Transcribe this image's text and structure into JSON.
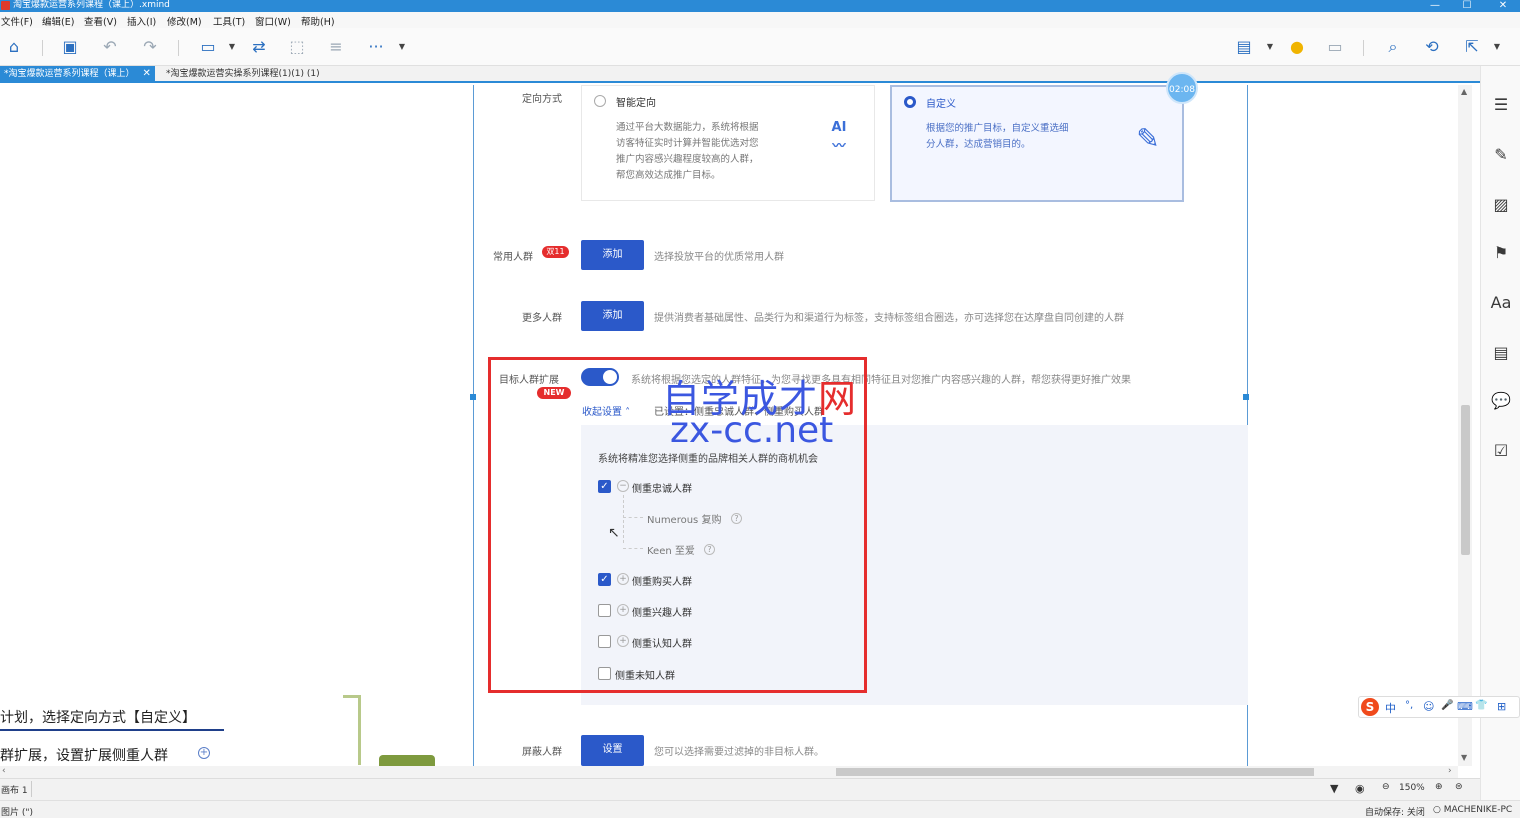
{
  "window": {
    "title": "淘宝爆款运营系列课程（课上）.xmind",
    "controls": [
      "—",
      "☐",
      "✕"
    ]
  },
  "menu": [
    "文件(F)",
    "编辑(E)",
    "查看(V)",
    "插入(I)",
    "修改(M)",
    "工具(T)",
    "窗口(W)",
    "帮助(H)"
  ],
  "toolbar": {
    "left_icons": [
      "home-icon",
      "save-icon",
      "undo-icon",
      "redo-icon",
      "topic-icon",
      "relationship-icon",
      "boundary-icon",
      "summary-icon",
      "more-icon"
    ],
    "right_icons": [
      "presentation-icon",
      "idea-icon",
      "layout-icon",
      "search-icon",
      "share-icon",
      "export-icon"
    ]
  },
  "tabs": [
    {
      "label": "*淘宝爆款运营系列课程（课上）",
      "active": true
    },
    {
      "label": "*淘宝爆款运营实操系列课程(1)(1) (1)",
      "active": false
    }
  ],
  "right_sidebar": [
    "outline-icon",
    "format-icon",
    "image-icon",
    "marker-icon",
    "style-icon",
    "notes-icon",
    "comment-icon",
    "task-icon"
  ],
  "shot": {
    "timer": "02:08",
    "targeting": {
      "label": "定向方式",
      "options": [
        {
          "title": "智能定向",
          "desc": [
            "通过平台大数据能力，系统将根据",
            "访客特征实时计算并智能优选对您",
            "推广内容感兴趣程度较高的人群，",
            "帮您高效达成推广目标。"
          ],
          "selected": false,
          "icon_label": "AI"
        },
        {
          "title": "自定义",
          "desc": [
            "根据您的推广目标，自定义重选细",
            "分人群，达成营销目的。"
          ],
          "selected": true
        }
      ]
    },
    "common_crowd": {
      "label": "常用人群",
      "badge": "双11",
      "button": "添加",
      "hint": "选择投放平台的优质常用人群"
    },
    "more_crowd": {
      "label": "更多人群",
      "button": "添加",
      "hint": "提供消费者基础属性、品类行为和渠道行为标签，支持标签组合圈选，亦可选择您在达摩盘自同创建的人群"
    },
    "expand": {
      "label": "目标人群扩展",
      "badge": "NEW",
      "desc": "系统将根据您选定的人群特征，为您寻找更多具有相同特征且对您推广内容感兴趣的人群，帮您获得更好推广效果",
      "collapse_label": "收起设置",
      "set_label": "已设置：侧重忠诚人群、侧重购买人群",
      "panel_title": "系统将精准您选择侧重的品牌相关人群的商机机会",
      "options": [
        {
          "label": "侧重忠诚人群",
          "checked": true,
          "expanded": true
        },
        {
          "label": "Numerous 复购",
          "sub": true
        },
        {
          "label": "Keen 至爱",
          "sub": true
        },
        {
          "label": "侧重购买人群",
          "checked": true
        },
        {
          "label": "侧重兴趣人群",
          "checked": false
        },
        {
          "label": "侧重认知人群",
          "checked": false
        },
        {
          "label": "侧重未知人群",
          "checked": false
        }
      ]
    },
    "exclude": {
      "label": "屏蔽人群",
      "button": "设置",
      "hint": "您可以选择需要过滤掉的非目标人群。"
    }
  },
  "watermark": {
    "line1_a": "自学成才",
    "line1_b": "网",
    "line2": "zx-cc.net"
  },
  "mindmap": {
    "line1": "计划，选择定向方式【自定义】",
    "line2": "群扩展，设置扩展侧重人群"
  },
  "status": {
    "sheet": "画布 1",
    "zoom": "150%",
    "bottom_left": "图片 (\")",
    "autosave": "自动保存: 关闭",
    "computer": "MACHENIKE-PC"
  },
  "ime": [
    "中",
    "°,",
    "☺",
    "🎤",
    "⌨",
    "👕",
    "⊞"
  ],
  "colors": {
    "accent": "#2b8ad6",
    "brand_blue": "#2b59c9",
    "highlight_red": "#e52d2d"
  }
}
